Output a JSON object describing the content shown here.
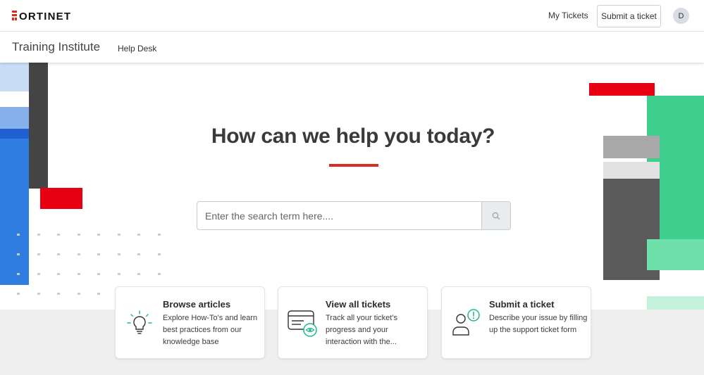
{
  "header": {
    "logo_text": "FORTINET",
    "my_tickets_label": "My Tickets",
    "submit_ticket_label": "Submit a ticket",
    "avatar_initial": "D"
  },
  "subheader": {
    "brand": "Training Institute",
    "help_desk_label": "Help Desk"
  },
  "hero": {
    "headline": "How can we help you today?",
    "search_placeholder": "Enter the search term here...."
  },
  "cards": [
    {
      "title": "Browse articles",
      "description": "Explore How-To's and learn best practices from our knowledge base",
      "icon": "lightbulb-icon"
    },
    {
      "title": "View all tickets",
      "description": "Track all your ticket's progress and your interaction with the...",
      "icon": "ticket-view-icon"
    },
    {
      "title": "Submit a ticket",
      "description": "Describe your issue by filling up the support ticket form",
      "icon": "user-alert-icon"
    }
  ],
  "colors": {
    "brand_red": "#da2c22",
    "accent_green": "#3ecf8e",
    "accent_blue": "#2f7de1",
    "icon_teal": "#1fb590",
    "dark_gray": "#555555"
  }
}
